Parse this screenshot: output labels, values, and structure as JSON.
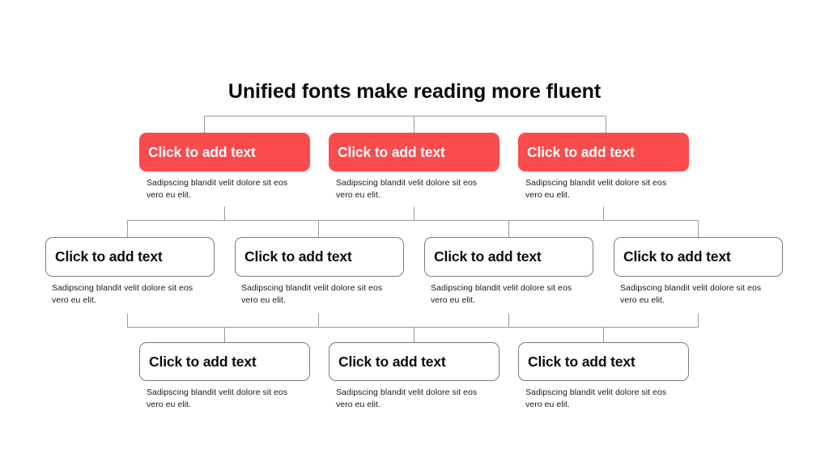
{
  "slide": {
    "title": "Unified fonts make reading more fluent",
    "background_color": "#ffffff",
    "accent_color": "#fa4b4d",
    "outline_color": "#7c7c7c",
    "text_color": "#0d0d0d",
    "connector_color": "#9a9a9a"
  },
  "default_caption": "Sadipscing blandit velit dolore sit eos vero eu elit.",
  "rows": [
    {
      "name": "row-1",
      "style": "filled",
      "nodes": [
        {
          "label": "Click to add text",
          "caption": "Sadipscing blandit velit dolore sit eos vero eu elit."
        },
        {
          "label": "Click to add text",
          "caption": "Sadipscing blandit velit dolore sit eos vero eu elit."
        },
        {
          "label": "Click to add text",
          "caption": "Sadipscing blandit velit dolore sit eos vero eu elit."
        }
      ]
    },
    {
      "name": "row-2",
      "style": "outline",
      "nodes": [
        {
          "label": "Click to add text",
          "caption": "Sadipscing blandit velit dolore sit eos vero eu elit."
        },
        {
          "label": "Click to add text",
          "caption": "Sadipscing blandit velit dolore sit eos vero eu elit."
        },
        {
          "label": "Click to add text",
          "caption": "Sadipscing blandit velit dolore sit eos vero eu elit."
        },
        {
          "label": "Click to add text",
          "caption": "Sadipscing blandit velit dolore sit eos vero eu elit."
        }
      ]
    },
    {
      "name": "row-3",
      "style": "outline",
      "nodes": [
        {
          "label": "Click to add text",
          "caption": "Sadipscing blandit velit dolore sit eos vero eu elit."
        },
        {
          "label": "Click to add text",
          "caption": "Sadipscing blandit velit dolore sit eos vero eu elit."
        },
        {
          "label": "Click to add text",
          "caption": "Sadipscing blandit velit dolore sit eos vero eu elit."
        }
      ]
    }
  ]
}
